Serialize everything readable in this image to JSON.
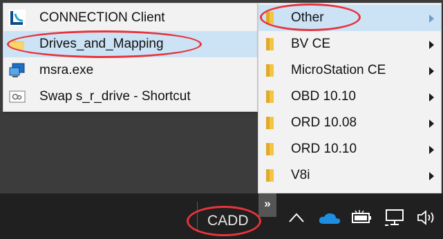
{
  "left_menu": {
    "items": [
      {
        "label": "CONNECTION Client",
        "icon": "connection-client-icon"
      },
      {
        "label": "Drives_and_Mapping",
        "icon": "folder-icon"
      },
      {
        "label": "msra.exe",
        "icon": "remote-assistance-icon"
      },
      {
        "label": "Swap s_r_drive - Shortcut",
        "icon": "shortcut-icon"
      }
    ],
    "highlighted": "Drives_and_Mapping"
  },
  "flyout_menu": {
    "items": [
      {
        "label": "Other"
      },
      {
        "label": "BV CE"
      },
      {
        "label": "MicroStation CE"
      },
      {
        "label": "OBD 10.10"
      },
      {
        "label": "ORD 10.08"
      },
      {
        "label": "ORD 10.10"
      },
      {
        "label": "V8i"
      }
    ],
    "highlighted": "Other"
  },
  "taskbar": {
    "toolbar_label": "CADD",
    "overflow_button": "»",
    "tray_icons": [
      "chevron-up-icon",
      "onedrive-icon",
      "battery-icon",
      "network-icon",
      "volume-icon"
    ]
  },
  "colors": {
    "annotation_red": "#e8333c",
    "menu_highlight": "#cce3f5",
    "menu_background": "#f2f2f2",
    "taskbar": "#202020",
    "folder_yellow": "#f4c542",
    "onedrive_blue": "#1e8fe0"
  }
}
